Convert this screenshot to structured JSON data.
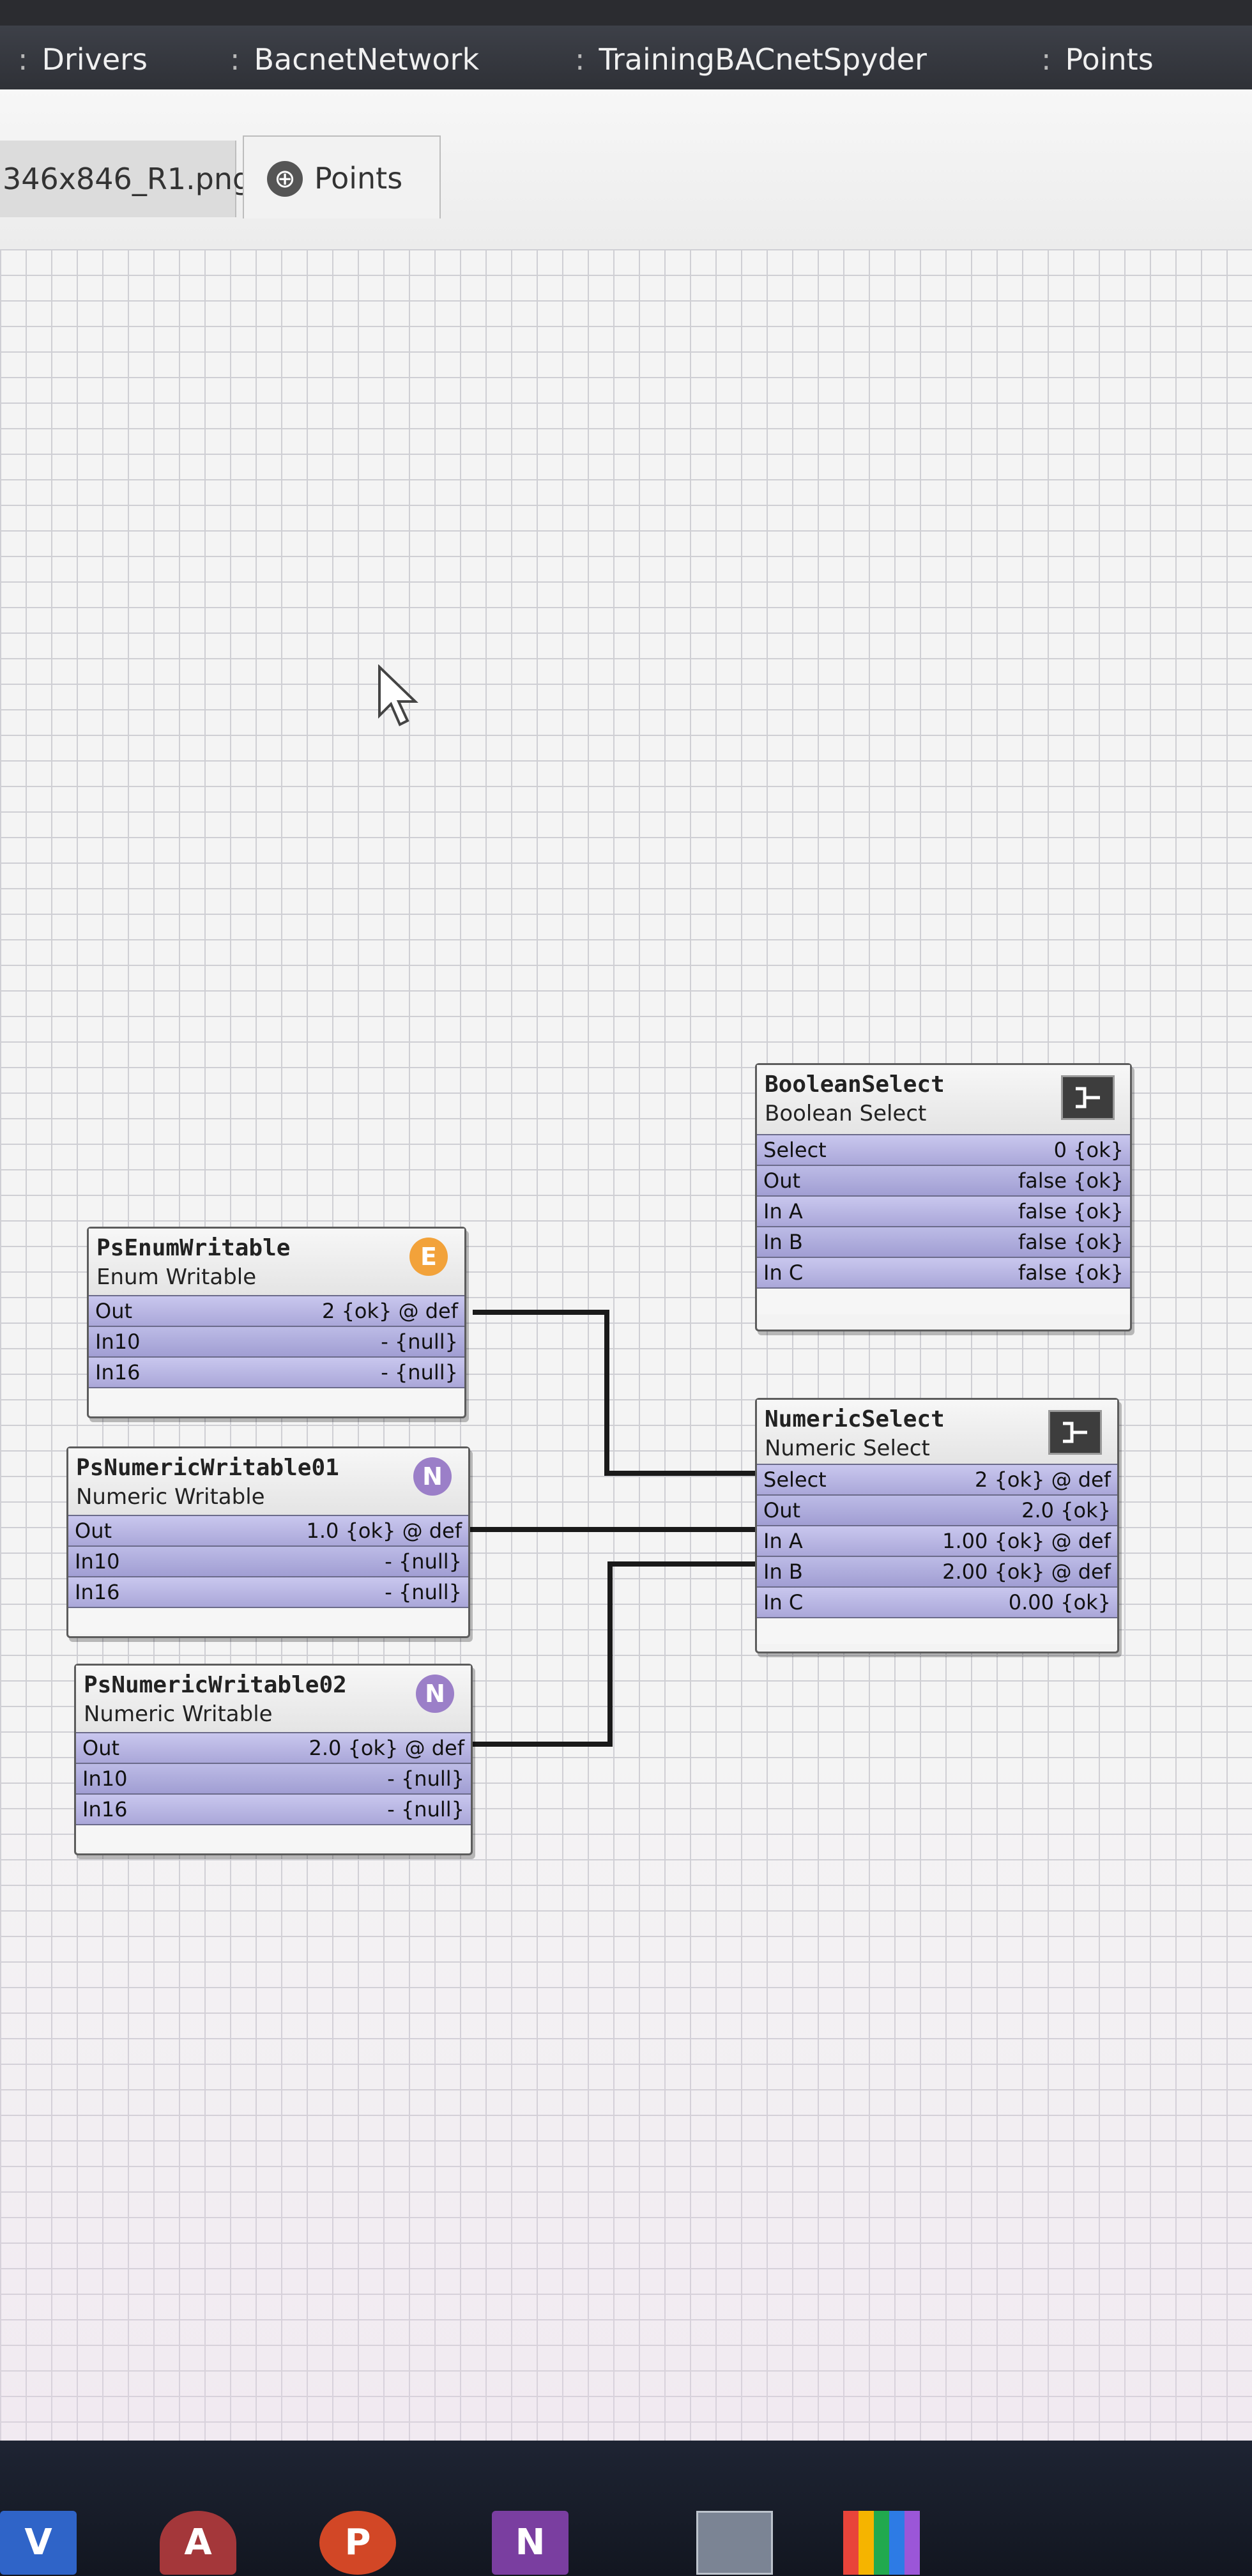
{
  "breadcrumb": {
    "items": [
      "Drivers",
      "BacnetNetwork",
      "TrainingBACnetSpyder",
      "Points"
    ],
    "separator": ":"
  },
  "tabs": [
    {
      "label": "346x846_R1.png"
    },
    {
      "label": "Points",
      "icon": "points-globe-icon"
    }
  ],
  "components": {
    "boolean_select": {
      "name": "BooleanSelect",
      "type": "Boolean Select",
      "icon": "select-icon",
      "slots": [
        {
          "label": "Select",
          "value": "0 {ok}"
        },
        {
          "label": "Out",
          "value": "false {ok}"
        },
        {
          "label": "In A",
          "value": "false {ok}"
        },
        {
          "label": "In B",
          "value": "false {ok}"
        },
        {
          "label": "In C",
          "value": "false {ok}"
        }
      ]
    },
    "enum_writable": {
      "name": "PsEnumWritable",
      "type": "Enum Writable",
      "badge": "E",
      "badge_color": "#f2a23a",
      "slots": [
        {
          "label": "Out",
          "value": "2 {ok} @ def"
        },
        {
          "label": "In10",
          "value": "- {null}"
        },
        {
          "label": "In16",
          "value": "- {null}"
        }
      ]
    },
    "numeric_writable_01": {
      "name": "PsNumericWritable01",
      "type": "Numeric Writable",
      "badge": "N",
      "badge_color": "#9b7fc8",
      "slots": [
        {
          "label": "Out",
          "value": "1.0 {ok} @ def"
        },
        {
          "label": "In10",
          "value": "- {null}"
        },
        {
          "label": "In16",
          "value": "- {null}"
        }
      ]
    },
    "numeric_writable_02": {
      "name": "PsNumericWritable02",
      "type": "Numeric Writable",
      "badge": "N",
      "badge_color": "#9b7fc8",
      "slots": [
        {
          "label": "Out",
          "value": "2.0 {ok} @ def"
        },
        {
          "label": "In10",
          "value": "- {null}"
        },
        {
          "label": "In16",
          "value": "- {null}"
        }
      ]
    },
    "numeric_select": {
      "name": "NumericSelect",
      "type": "Numeric Select",
      "icon": "select-icon",
      "slots": [
        {
          "label": "Select",
          "value": "2 {ok} @ def"
        },
        {
          "label": "Out",
          "value": "2.0 {ok}"
        },
        {
          "label": "In A",
          "value": "1.00 {ok} @ def"
        },
        {
          "label": "In B",
          "value": "2.00 {ok} @ def"
        },
        {
          "label": "In C",
          "value": "0.00 {ok}"
        }
      ]
    }
  },
  "links": [
    {
      "from": "PsEnumWritable.Out",
      "to": "NumericSelect.Select"
    },
    {
      "from": "PsNumericWritable01.Out",
      "to": "NumericSelect.In A"
    },
    {
      "from": "PsNumericWritable02.Out",
      "to": "NumericSelect.In B"
    }
  ],
  "taskbar": {
    "apps": [
      {
        "name": "visio-icon",
        "letter": "V",
        "color": "#2f64c8"
      },
      {
        "name": "access-icon",
        "letter": "A",
        "color": "#a4373a"
      },
      {
        "name": "powerpoint-icon",
        "letter": "P",
        "color": "#d24726"
      },
      {
        "name": "onenote-icon",
        "letter": "N",
        "color": "#7a3ea0"
      }
    ]
  }
}
